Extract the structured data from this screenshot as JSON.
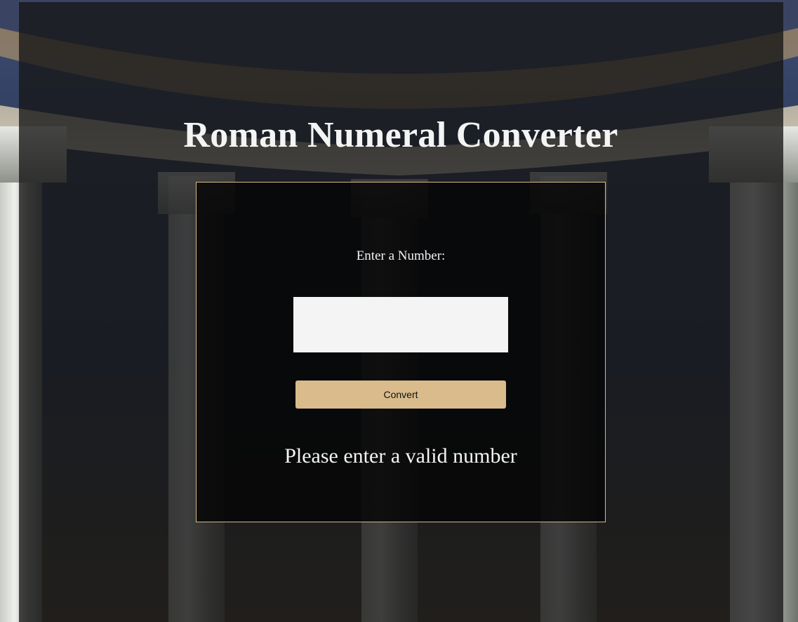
{
  "page": {
    "title": "Roman Numeral Converter"
  },
  "form": {
    "label": "Enter a Number:",
    "input_value": "",
    "button_label": "Convert"
  },
  "output": {
    "message": "Please enter a valid number"
  },
  "colors": {
    "accent": "#d9bb8c",
    "panel_border": "#d8b888",
    "text": "#f4f4f4",
    "input_bg": "#f4f4f4"
  }
}
